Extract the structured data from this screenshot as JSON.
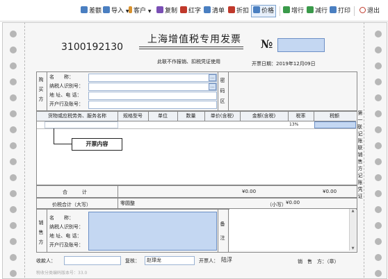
{
  "toolbar": {
    "buttons": [
      {
        "label": "差额",
        "icon": "diff-icon",
        "color": "#4a7fc1"
      },
      {
        "label": "导入",
        "icon": "import-icon",
        "color": "#4a7fc1",
        "dropdown": true
      },
      {
        "label": "客户",
        "icon": "customer-icon",
        "color": "#d9922e",
        "dropdown": true
      },
      {
        "label": "复制",
        "icon": "copy-icon",
        "color": "#7a4fb5"
      },
      {
        "label": "红字",
        "icon": "red-invoice-icon",
        "color": "#c0392b"
      },
      {
        "label": "清单",
        "icon": "list-icon",
        "color": "#4a7fc1"
      },
      {
        "label": "折扣",
        "icon": "discount-icon",
        "color": "#c0392b"
      },
      {
        "label": "价格",
        "icon": "price-icon",
        "color": "#4a7fc1",
        "active": true
      },
      {
        "label": "增行",
        "icon": "add-row-icon",
        "color": "#3a9a4a"
      },
      {
        "label": "减行",
        "icon": "remove-row-icon",
        "color": "#3a9a4a"
      },
      {
        "label": "打印",
        "icon": "print-icon",
        "color": "#4a7fc1"
      },
      {
        "label": "退出",
        "icon": "exit-icon",
        "color": "#c0392b"
      }
    ]
  },
  "invoice": {
    "code": "3100192130",
    "title": "上海增值税专用发票",
    "no_symbol": "№",
    "subtitle": "此联不作报销、扣税凭证使用",
    "date_label": "开票日期：",
    "date_value": "2019年12月09日",
    "buyer": {
      "section_label": [
        "购",
        "买",
        "方"
      ],
      "name_label": "名　　称：",
      "taxid_label": "纳税人识别号：",
      "address_label": "地 址、电 话：",
      "bank_label": "开户行及账号："
    },
    "cipher_label": [
      "密",
      "码",
      "区"
    ],
    "table": {
      "headers": [
        "货物或应税劳务、服务名称",
        "规格型号",
        "单位",
        "数量",
        "单价(含税)",
        "金额(含税)",
        "税率",
        "税额"
      ],
      "row": {
        "tax_rate": "13%"
      },
      "callout": "开票内容"
    },
    "side_label": [
      "第",
      "一",
      "联",
      "：",
      "记",
      "账",
      "联",
      "　",
      "销",
      "售",
      "方",
      "记",
      "账",
      "凭",
      "证"
    ],
    "total_label": "合　　　计",
    "total_amount": "¥0.00",
    "total_tax": "¥0.00",
    "sum_label": "价税合计（大写）",
    "sum_upper": "零圆整",
    "sum_small_label": "（小写）",
    "sum_small_value": "¥0.00",
    "seller": {
      "section_label": [
        "销",
        "售",
        "方"
      ],
      "name_label": "名　　称：",
      "taxid_label": "纳税人识别号：",
      "address_label": "地 址、电 话：",
      "bank_label": "开户行及账号："
    },
    "remarks_label": [
      "备",
      "注"
    ],
    "payee_label": "收款人：",
    "reviewer_label": "复核：",
    "reviewer_value": "赵璋龙",
    "issuer_label": "开票人：",
    "issuer_value": "陆浮",
    "seller_stamp_label": "销　售　方：（章）",
    "version_text": "税收分类编码版本号：33.0"
  }
}
